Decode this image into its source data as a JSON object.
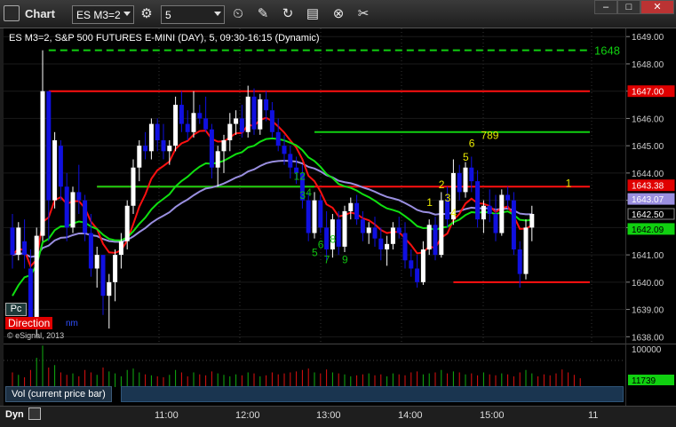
{
  "window": {
    "title": "Chart",
    "symbol": "ES M3=2",
    "interval": "5",
    "minimize": "–",
    "maximize": "□",
    "close": "✕"
  },
  "toolbar": {
    "icons": [
      "gear-icon",
      "clock-icon",
      "pencil-icon",
      "refresh-icon",
      "chart-settings-icon",
      "close-circle-icon",
      "tools-icon"
    ]
  },
  "chart": {
    "header": "ES M3=2, S&P 500 FUTURES E-MINI (DAY), 5, 09:30-16:15 (Dynamic)",
    "pc_label": "Pc",
    "direction_label": "Direction",
    "direction_extra": "nm",
    "copyright": "© eSignal, 2013",
    "dashed_level_label": "1648"
  },
  "price_axis": {
    "ticks": [
      "1649.00",
      "1648.00",
      "1647.00",
      "1646.00",
      "1645.00",
      "1644.00",
      "1643.00",
      "1642.00",
      "1641.00",
      "1640.00",
      "1639.00",
      "1638.00"
    ],
    "labels": [
      {
        "text": "1647.00",
        "bg": "#e00000",
        "fg": "#ffffff"
      },
      {
        "text": "1643.38",
        "bg": "#e00000",
        "fg": "#ffffff"
      },
      {
        "text": "1643.07",
        "bg": "#9a8fe0",
        "fg": "#ffffff"
      },
      {
        "text": "1642.50",
        "bg": "#000000",
        "fg": "#ffffff"
      },
      {
        "text": "1642.09",
        "bg": "#10d010",
        "fg": "#000000"
      }
    ]
  },
  "volume": {
    "label": "Vol (current price bar)",
    "axis_top": "100000",
    "axis_value": "11739"
  },
  "time_axis": {
    "dyn_label": "Dyn",
    "labels": [
      "11:00",
      "12:00",
      "13:00",
      "14:00",
      "15:00",
      "11"
    ]
  },
  "colors": {
    "bull_candle": "#ffffff",
    "bear_candle": "#1010e0",
    "red_line": "#ff1010",
    "green_line": "#10e010",
    "purple_line": "#9a8fe0"
  },
  "chart_data": {
    "type": "candlestick",
    "ylim": [
      1637.75,
      1649.3
    ],
    "title": "ES M3=2, S&P 500 FUTURES E-MINI (DAY), 5, 09:30-16:15 (Dynamic)",
    "levels": [
      {
        "name": "dashed",
        "value": 1648.5,
        "color": "#10d010",
        "style": "dashed"
      },
      {
        "name": "resistance",
        "value": 1647.0,
        "color": "#ff1010",
        "from_bar": 6
      },
      {
        "name": "green-level",
        "value": 1645.5,
        "color": "#10d010",
        "from_bar": 50
      },
      {
        "name": "mid-red",
        "value": 1643.5,
        "color": "#ff1010",
        "from_bar": 14
      },
      {
        "name": "mid-green",
        "value": 1643.5,
        "color": "#10d010",
        "from_bar": 14,
        "to_bar": 50
      },
      {
        "name": "support",
        "value": 1640.0,
        "color": "#ff1010",
        "from_bar": 73
      }
    ],
    "bars": [
      [
        1642.0,
        1642.5,
        1640.5,
        1641.0
      ],
      [
        1641.0,
        1642.2,
        1640.8,
        1642.0
      ],
      [
        1641.5,
        1642.3,
        1640.5,
        1641.0
      ],
      [
        1640.5,
        1641.2,
        1638.3,
        1638.5
      ],
      [
        1638.5,
        1642.0,
        1638.0,
        1641.7
      ],
      [
        1641.7,
        1648.5,
        1641.5,
        1647.0
      ],
      [
        1647.0,
        1647.0,
        1641.5,
        1643.0
      ],
      [
        1643.0,
        1645.5,
        1642.7,
        1645.2
      ],
      [
        1645.0,
        1645.2,
        1643.0,
        1643.5
      ],
      [
        1643.5,
        1644.0,
        1641.5,
        1642.0
      ],
      [
        1642.0,
        1643.5,
        1641.8,
        1643.3
      ],
      [
        1643.3,
        1644.3,
        1642.5,
        1643.0
      ],
      [
        1643.0,
        1643.2,
        1641.5,
        1641.8
      ],
      [
        1641.8,
        1642.5,
        1640.2,
        1640.5
      ],
      [
        1640.5,
        1641.3,
        1639.8,
        1641.0
      ],
      [
        1641.0,
        1641.0,
        1638.8,
        1639.5
      ],
      [
        1639.5,
        1640.3,
        1638.3,
        1640.0
      ],
      [
        1640.0,
        1641.2,
        1639.3,
        1641.0
      ],
      [
        1641.0,
        1641.8,
        1640.5,
        1641.5
      ],
      [
        1641.5,
        1643.0,
        1641.2,
        1642.8
      ],
      [
        1642.8,
        1644.5,
        1642.5,
        1644.2
      ],
      [
        1644.2,
        1645.2,
        1643.7,
        1645.0
      ],
      [
        1645.0,
        1645.5,
        1644.5,
        1644.8
      ],
      [
        1644.8,
        1646.0,
        1644.5,
        1645.8
      ],
      [
        1645.8,
        1646.0,
        1644.8,
        1645.2
      ],
      [
        1645.2,
        1645.8,
        1644.5,
        1644.8
      ],
      [
        1644.8,
        1645.2,
        1644.3,
        1645.0
      ],
      [
        1645.0,
        1646.8,
        1644.8,
        1646.5
      ],
      [
        1646.5,
        1647.0,
        1645.5,
        1645.8
      ],
      [
        1645.8,
        1646.3,
        1645.2,
        1645.5
      ],
      [
        1645.5,
        1647.0,
        1645.3,
        1646.2
      ],
      [
        1646.2,
        1646.5,
        1645.8,
        1646.0
      ],
      [
        1646.0,
        1646.8,
        1645.5,
        1645.6
      ],
      [
        1645.6,
        1645.8,
        1643.8,
        1644.2
      ],
      [
        1644.2,
        1645.0,
        1643.5,
        1644.8
      ],
      [
        1644.8,
        1645.4,
        1644.0,
        1645.2
      ],
      [
        1645.2,
        1646.2,
        1644.8,
        1645.8
      ],
      [
        1645.8,
        1646.3,
        1645.4,
        1646.0
      ],
      [
        1646.0,
        1646.5,
        1645.3,
        1645.5
      ],
      [
        1645.5,
        1647.2,
        1645.3,
        1646.8
      ],
      [
        1646.8,
        1647.1,
        1645.4,
        1645.6
      ],
      [
        1645.6,
        1646.9,
        1645.4,
        1646.7
      ],
      [
        1646.7,
        1647.0,
        1645.9,
        1646.3
      ],
      [
        1646.3,
        1646.6,
        1645.3,
        1645.5
      ],
      [
        1645.5,
        1646.0,
        1644.8,
        1645.0
      ],
      [
        1645.0,
        1645.4,
        1644.3,
        1644.7
      ],
      [
        1644.7,
        1645.0,
        1643.8,
        1644.2
      ],
      [
        1644.2,
        1644.6,
        1643.6,
        1644.0
      ],
      [
        1644.0,
        1644.3,
        1642.7,
        1643.0
      ],
      [
        1643.0,
        1643.3,
        1641.5,
        1641.8
      ],
      [
        1641.8,
        1643.3,
        1641.6,
        1643.0
      ],
      [
        1643.0,
        1643.2,
        1641.8,
        1642.0
      ],
      [
        1642.0,
        1642.6,
        1640.8,
        1641.2
      ],
      [
        1641.2,
        1642.5,
        1640.9,
        1642.3
      ],
      [
        1642.3,
        1642.6,
        1641.0,
        1641.3
      ],
      [
        1641.3,
        1642.8,
        1641.1,
        1642.6
      ],
      [
        1642.6,
        1643.1,
        1642.3,
        1642.9
      ],
      [
        1642.9,
        1643.2,
        1642.1,
        1642.3
      ],
      [
        1642.3,
        1642.6,
        1641.5,
        1641.8
      ],
      [
        1641.8,
        1642.2,
        1641.4,
        1642.0
      ],
      [
        1642.0,
        1642.4,
        1641.3,
        1641.6
      ],
      [
        1641.6,
        1642.0,
        1640.8,
        1641.2
      ],
      [
        1641.2,
        1641.7,
        1640.6,
        1641.4
      ],
      [
        1641.4,
        1642.2,
        1641.2,
        1642.0
      ],
      [
        1642.0,
        1642.4,
        1641.6,
        1641.8
      ],
      [
        1641.8,
        1642.2,
        1640.5,
        1640.8
      ],
      [
        1640.8,
        1641.2,
        1640.2,
        1640.5
      ],
      [
        1640.5,
        1641.0,
        1639.8,
        1640.0
      ],
      [
        1640.0,
        1641.5,
        1639.9,
        1641.2
      ],
      [
        1641.2,
        1642.3,
        1641.0,
        1642.1
      ],
      [
        1642.1,
        1642.4,
        1640.8,
        1641.0
      ],
      [
        1641.0,
        1643.3,
        1640.9,
        1643.0
      ],
      [
        1643.0,
        1643.5,
        1642.0,
        1642.3
      ],
      [
        1642.3,
        1644.5,
        1642.1,
        1644.0
      ],
      [
        1644.0,
        1644.3,
        1643.0,
        1643.3
      ],
      [
        1643.3,
        1644.4,
        1643.1,
        1644.2
      ],
      [
        1644.2,
        1644.6,
        1643.3,
        1643.7
      ],
      [
        1643.7,
        1644.1,
        1642.0,
        1642.3
      ],
      [
        1642.3,
        1643.0,
        1641.8,
        1642.8
      ],
      [
        1642.8,
        1643.4,
        1642.2,
        1642.5
      ],
      [
        1642.5,
        1643.2,
        1641.5,
        1641.8
      ],
      [
        1641.8,
        1643.4,
        1641.7,
        1643.2
      ],
      [
        1643.2,
        1643.5,
        1642.7,
        1643.0
      ],
      [
        1643.0,
        1643.3,
        1641.0,
        1641.2
      ],
      [
        1641.2,
        1641.5,
        1639.8,
        1640.3
      ],
      [
        1640.3,
        1642.3,
        1640.1,
        1642.0
      ],
      [
        1642.0,
        1642.8,
        1641.5,
        1642.5
      ]
    ],
    "annotations": [
      {
        "text": "12",
        "bar": 47,
        "price": 1643.75,
        "color": "#10c010"
      },
      {
        "text": "3",
        "bar": 48,
        "price": 1643.05,
        "color": "#10c010"
      },
      {
        "text": "4",
        "bar": 49,
        "price": 1643.15,
        "color": "#10c010"
      },
      {
        "text": "5",
        "bar": 50,
        "price": 1640.95,
        "color": "#10c010"
      },
      {
        "text": "6",
        "bar": 51,
        "price": 1641.25,
        "color": "#10c010"
      },
      {
        "text": "7",
        "bar": 52,
        "price": 1640.7,
        "color": "#10c010"
      },
      {
        "text": "8",
        "bar": 53,
        "price": 1641.45,
        "color": "#10c010"
      },
      {
        "text": "9",
        "bar": 55,
        "price": 1640.7,
        "color": "#10c010"
      },
      {
        "text": "1",
        "bar": 69,
        "price": 1642.8,
        "color": "#e8e800"
      },
      {
        "text": "2",
        "bar": 71,
        "price": 1643.45,
        "color": "#e8e800"
      },
      {
        "text": "3",
        "bar": 72,
        "price": 1642.95,
        "color": "#e8e800"
      },
      {
        "text": "4",
        "bar": 73,
        "price": 1642.4,
        "color": "#e8e800"
      },
      {
        "text": "5",
        "bar": 75,
        "price": 1644.45,
        "color": "#e8e800"
      },
      {
        "text": "6",
        "bar": 76,
        "price": 1644.95,
        "color": "#e8e800"
      },
      {
        "text": "789",
        "bar": 78,
        "price": 1645.25,
        "color": "#e8e800"
      },
      {
        "text": "1",
        "bar": 92,
        "price": 1643.5,
        "color": "#e8e800"
      }
    ],
    "volume": [
      30,
      25,
      20,
      35,
      60,
      85,
      40,
      45,
      30,
      25,
      28,
      22,
      35,
      30,
      25,
      40,
      32,
      28,
      22,
      35,
      38,
      30,
      26,
      24,
      22,
      20,
      25,
      35,
      30,
      22,
      30,
      26,
      24,
      32,
      28,
      25,
      22,
      26,
      24,
      30,
      28,
      22,
      24,
      30,
      26,
      28,
      30,
      32,
      35,
      38,
      30,
      28,
      36,
      30,
      28,
      26,
      22,
      24,
      26,
      28,
      24,
      26,
      22,
      28,
      26,
      24,
      30,
      32,
      26,
      28,
      30,
      35,
      28,
      32,
      30,
      26,
      28,
      24,
      30,
      26,
      24,
      28,
      26,
      22,
      30,
      35,
      28,
      22,
      26,
      24,
      28,
      36,
      30,
      25,
      18
    ]
  }
}
